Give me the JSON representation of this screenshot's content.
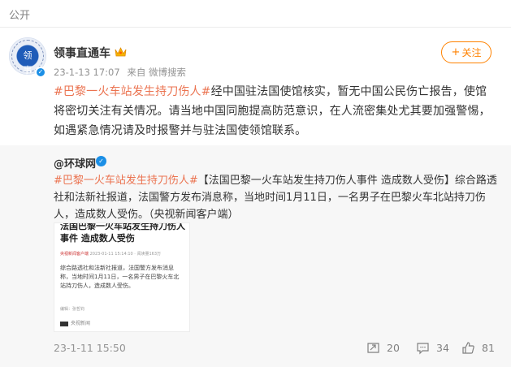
{
  "visibility_label": "公开",
  "author": {
    "name": "领事直通车",
    "avatar_text": "领事",
    "time": "23-1-13 17:07",
    "source": "来自 微博搜索"
  },
  "follow_label": "关注",
  "post": {
    "tag": "#巴黎一火车站发生持刀伤人#",
    "text": "经中国驻法国使馆核实，暂无中国公民伤亡报告，使馆将密切关注有关情况。请当地中国同胞提高防范意识，在人流密集处尤其要加强警惕，如遇紧急情况请及时报警并与驻法国使领馆联系。"
  },
  "repost": {
    "user": "@环球网",
    "tag": "#巴黎一火车站发生持刀伤人#",
    "text": "【法国巴黎一火车站发生持刀伤人事件 造成数人受伤】综合路透社和法新社报道，法国警方发布消息称，当地时间1月11日，一名男子在巴黎火车北站持刀伤人，造成数人受伤。（央视新闻客户端）",
    "article": {
      "title": "法国巴黎一火车站发生持刀伤人事件 造成数人受伤",
      "source": "央视新闻客户端",
      "source_date": "2023-01-11 15:14:10 · 阅读量163万",
      "body": "综合路透社和法新社报道，法国警方发布消息称，当地时间1月11日，一名男子在巴黎火车北站持刀伤人，造成数人受伤。",
      "editor": "编辑：张哲钧",
      "footer": "央视新闻"
    },
    "date": "23-1-11 15:50",
    "actions": {
      "reposts": "20",
      "comments": "34",
      "likes": "81"
    }
  },
  "colors": {
    "accent": "#ff8200",
    "tag": "#eb7350",
    "verified": "#1b8fe6"
  },
  "icons": [
    "crown-icon",
    "verified-icon",
    "repost-icon",
    "comment-icon",
    "like-icon",
    "plus-icon"
  ]
}
